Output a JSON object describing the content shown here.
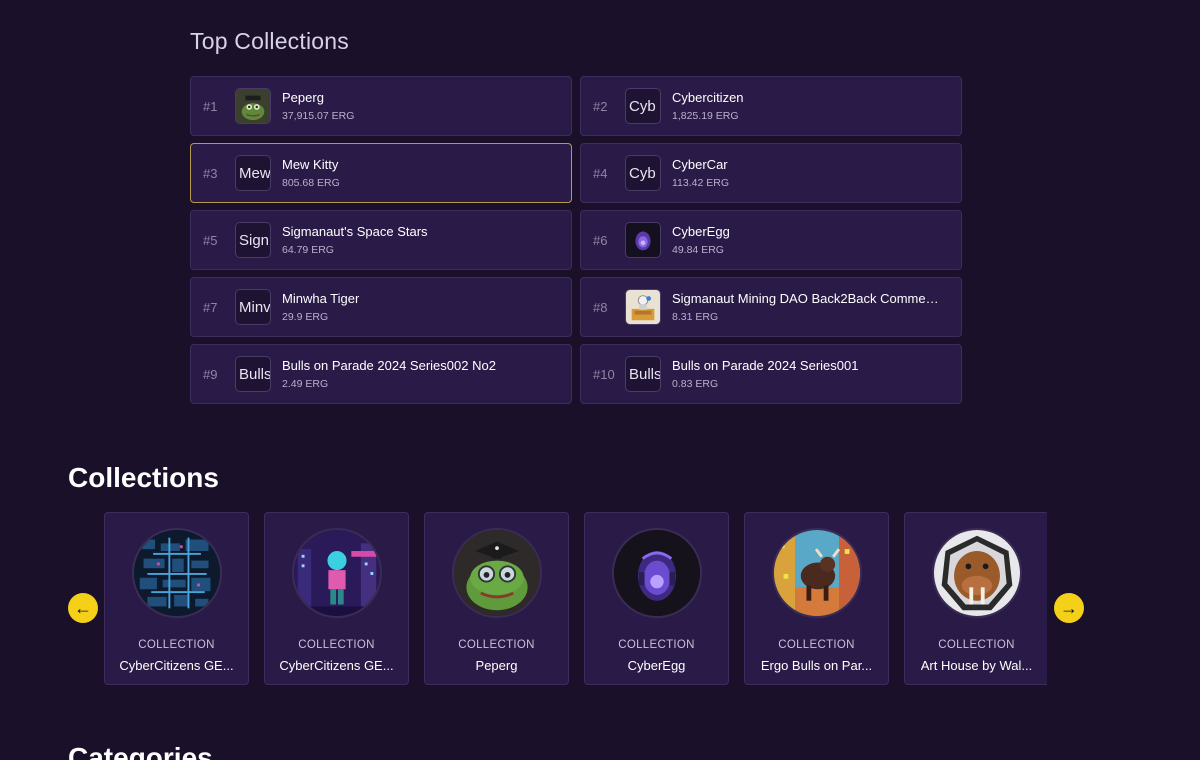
{
  "top_collections": {
    "title": "Top Collections",
    "items": [
      {
        "rank": "#1",
        "thumb": "",
        "thumb_kind": "frog-image",
        "name": "Peperg",
        "volume": "37,915.07 ERG"
      },
      {
        "rank": "#2",
        "thumb": "Cyb",
        "thumb_kind": "text",
        "name": "Cybercitizen",
        "volume": "1,825.19 ERG"
      },
      {
        "rank": "#3",
        "thumb": "Mew",
        "thumb_kind": "text",
        "name": "Mew Kitty",
        "volume": "805.68 ERG"
      },
      {
        "rank": "#4",
        "thumb": "Cyb",
        "thumb_kind": "text",
        "name": "CyberCar",
        "volume": "113.42 ERG"
      },
      {
        "rank": "#5",
        "thumb": "Sign",
        "thumb_kind": "text",
        "name": "Sigmanaut's Space Stars",
        "volume": "64.79 ERG"
      },
      {
        "rank": "#6",
        "thumb": "",
        "thumb_kind": "egg-image",
        "name": "CyberEgg",
        "volume": "49.84 ERG"
      },
      {
        "rank": "#7",
        "thumb": "Minv",
        "thumb_kind": "text",
        "name": "Minwha Tiger",
        "volume": "29.9 ERG"
      },
      {
        "rank": "#8",
        "thumb": "",
        "thumb_kind": "miner-image",
        "name": "Sigmanaut Mining DAO Back2Back Commem...",
        "volume": "8.31 ERG"
      },
      {
        "rank": "#9",
        "thumb": "Bulls",
        "thumb_kind": "text",
        "name": "Bulls on Parade 2024 Series002 No2",
        "volume": "2.49 ERG"
      },
      {
        "rank": "#10",
        "thumb": "Bulls",
        "thumb_kind": "text",
        "name": "Bulls on Parade 2024 Series001",
        "volume": "0.83 ERG"
      }
    ]
  },
  "collections": {
    "title": "Collections",
    "prev_label": "←",
    "next_label": "→",
    "items": [
      {
        "type": "COLLECTION",
        "name": "CyberCitizens GE...",
        "avatar": "cyber-city-map"
      },
      {
        "type": "COLLECTION",
        "name": "CyberCitizens GE...",
        "avatar": "cyber-citizen-character"
      },
      {
        "type": "COLLECTION",
        "name": "Peperg",
        "avatar": "frog-graduate"
      },
      {
        "type": "COLLECTION",
        "name": "CyberEgg",
        "avatar": "cyber-egg"
      },
      {
        "type": "COLLECTION",
        "name": "Ergo Bulls on Par...",
        "avatar": "bull-painting"
      },
      {
        "type": "COLLECTION",
        "name": "Art House by Wal...",
        "avatar": "walrus"
      }
    ]
  },
  "categories": {
    "title": "Categories"
  },
  "colors": {
    "background": "#1b1029",
    "card": "#2a1a47",
    "card_border": "#3e2d5c",
    "highlight_border": "#b49a4a",
    "arrow": "#f4d019"
  }
}
